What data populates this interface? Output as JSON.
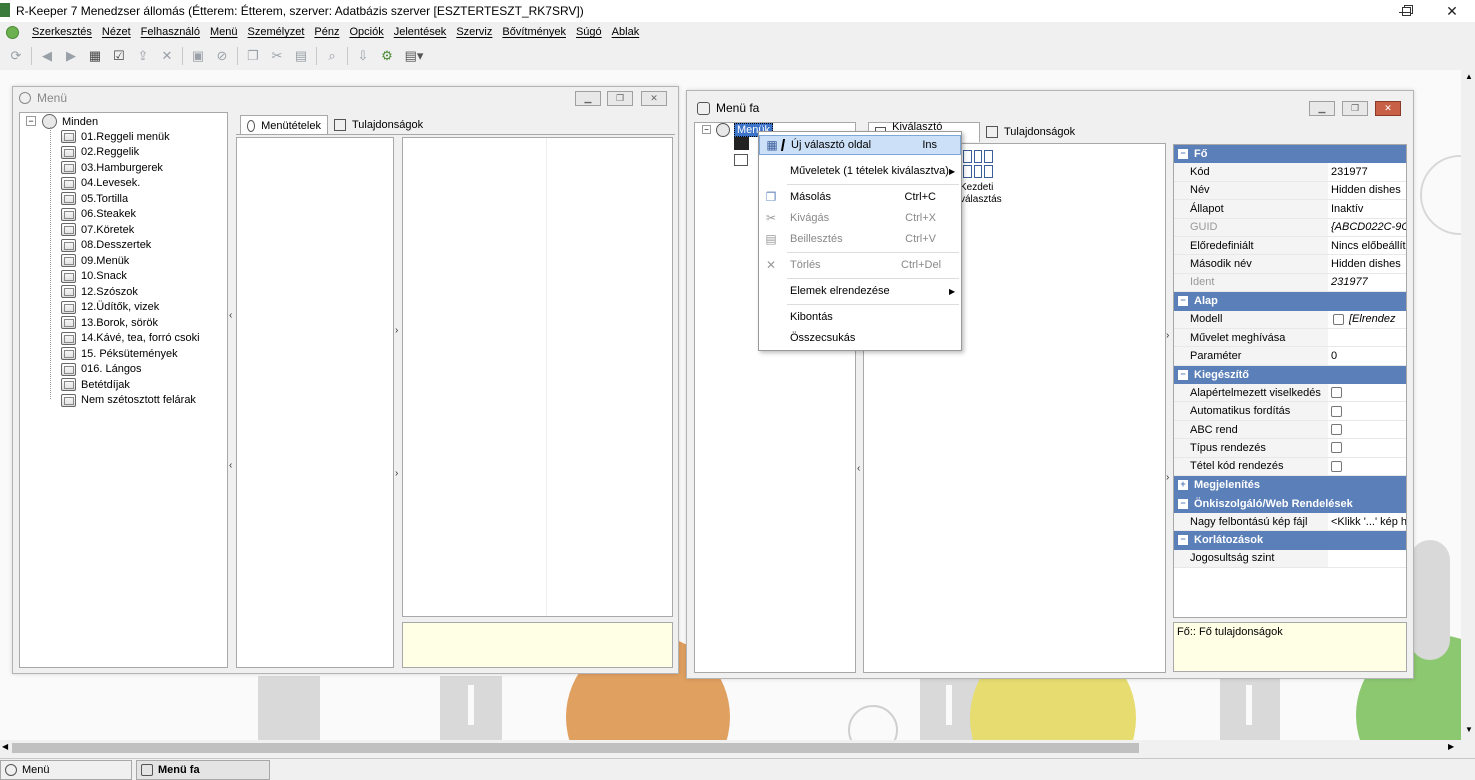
{
  "app": {
    "title": "R-Keeper 7 Menedzser állomás (Étterem: Étterem, szerver: Adatbázis szerver [ESZTERTESZT_RK7SRV])"
  },
  "menubar": [
    "Szerkesztés",
    "Nézet",
    "Felhasználó",
    "Menü",
    "Személyzet",
    "Pénz",
    "Opciók",
    "Jelentések",
    "Szerviz",
    "Bővítmények",
    "Súgó",
    "Ablak"
  ],
  "win_menu": {
    "title": "Menü",
    "tree_root": "Minden",
    "tree_items": [
      "01.Reggeli menük",
      "02.Reggelik",
      "03.Hamburgerek",
      "04.Levesek.",
      "05.Tortilla",
      "06.Steakek",
      "07.Köretek",
      "08.Desszertek",
      "09.Menük",
      "10.Snack",
      "12.Szószok",
      "12.Üdítők, vizek",
      "13.Borok, sörök",
      "14.Kávé, tea, forró csoki",
      "15. Péksütemények",
      "016. Lángos",
      "Betétdíjak",
      "Nem szétosztott felárak"
    ],
    "tab1": "Menütételek",
    "tab2": "Tulajdonságok"
  },
  "win_tree": {
    "title": "Menü fa",
    "root": "Menük",
    "tab1": "Kiválasztó oldalak",
    "tab2": "Tulajdonságok",
    "icon_caption_1": "Kezdeti",
    "icon_caption_2": "választás",
    "footer": "Fő:: Fő tulajdonságok"
  },
  "context_menu": {
    "items": [
      {
        "label": "Új választó oldal",
        "shortcut": "Ins"
      },
      {
        "label": "Műveletek (1 tételek kiválasztva)",
        "shortcut": ""
      },
      {
        "label": "Másolás",
        "shortcut": "Ctrl+C"
      },
      {
        "label": "Kivágás",
        "shortcut": "Ctrl+X"
      },
      {
        "label": "Beillesztés",
        "shortcut": "Ctrl+V"
      },
      {
        "label": "Törlés",
        "shortcut": "Ctrl+Del"
      },
      {
        "label": "Elemek elrendezése",
        "shortcut": ""
      },
      {
        "label": "Kibontás",
        "shortcut": ""
      },
      {
        "label": "Összecsukás",
        "shortcut": ""
      }
    ]
  },
  "properties": {
    "fo": "Fő",
    "kod_label": "Kód",
    "kod_value": "231977",
    "nev_label": "Név",
    "nev_value": "Hidden dishes",
    "allapot_label": "Állapot",
    "allapot_value": "Inaktív",
    "guid_label": "GUID",
    "guid_value": "{ABCD022C-9C",
    "elore_label": "Előredefiniált",
    "elore_value": "Nincs előbeállítá",
    "masodik_label": "Második név",
    "masodik_value": "Hidden dishes",
    "ident_label": "Ident",
    "ident_value": "231977",
    "alap": "Alap",
    "modell_label": "Modell",
    "modell_value": "[Elrendez",
    "muvelet_label": "Művelet meghívása",
    "param_label": "Paraméter",
    "param_value": "0",
    "kieg": "Kiegészítő",
    "alapert_label": "Alapértelmezett viselkedés",
    "auto_label": "Automatikus fordítás",
    "abc_label": "ABC rend",
    "tipus_label": "Típus rendezés",
    "tetel_label": "Tétel kód rendezés",
    "megj": "Megjelenítés",
    "onk": "Önkiszolgáló/Web Rendelések",
    "nagy_label": "Nagy felbontású kép fájl",
    "nagy_value": "<Klikk '...' kép h",
    "korl": "Korlátozások",
    "jog_label": "Jogosultság szint"
  },
  "taskbar": {
    "item1": "Menü",
    "item2": "Menü fa"
  }
}
